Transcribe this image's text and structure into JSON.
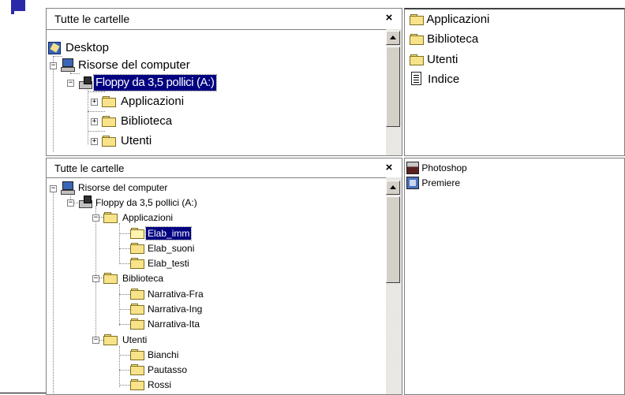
{
  "top_tree": {
    "title": "Tutte le cartelle",
    "close": "×",
    "items": [
      {
        "label": "Desktop"
      },
      {
        "label": "Risorse del computer"
      },
      {
        "label": "Floppy da 3,5 pollici (A:)"
      },
      {
        "label": "Applicazioni"
      },
      {
        "label": "Biblioteca"
      },
      {
        "label": "Utenti"
      }
    ]
  },
  "top_content": {
    "items": [
      {
        "label": "Applicazioni",
        "icon": "folder-icon"
      },
      {
        "label": "Biblioteca",
        "icon": "folder-icon"
      },
      {
        "label": "Utenti",
        "icon": "folder-icon"
      },
      {
        "label": "Indice",
        "icon": "document-icon"
      }
    ]
  },
  "bottom_tree": {
    "title": "Tutte le cartelle",
    "close": "×",
    "items": [
      {
        "label": "Risorse del computer"
      },
      {
        "label": "Floppy da 3,5 pollici (A:)"
      },
      {
        "label": "Applicazioni"
      },
      {
        "label": "Elab_imm"
      },
      {
        "label": "Elab_suoni"
      },
      {
        "label": "Elab_testi"
      },
      {
        "label": "Biblioteca"
      },
      {
        "label": "Narrativa-Fra"
      },
      {
        "label": "Narrativa-Ing"
      },
      {
        "label": "Narrativa-Ita"
      },
      {
        "label": "Utenti"
      },
      {
        "label": "Bianchi"
      },
      {
        "label": "Pautasso"
      },
      {
        "label": "Rossi"
      }
    ]
  },
  "bottom_content": {
    "items": [
      {
        "label": "Photoshop",
        "icon": "photoshop-icon"
      },
      {
        "label": "Premiere",
        "icon": "premiere-icon"
      }
    ]
  },
  "colors": {
    "selection": "#000080",
    "folder": "#f8e38a",
    "scrollbar": "#d4d0c8"
  }
}
